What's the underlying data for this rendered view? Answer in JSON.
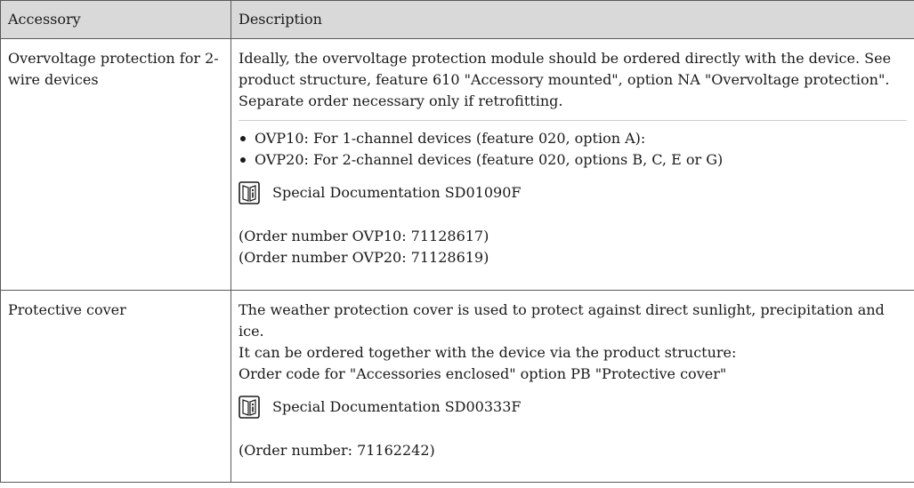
{
  "table": {
    "headers": [
      "Accessory",
      "Description"
    ],
    "rows": [
      {
        "accessory": "Overvoltage protection for 2-wire devices",
        "intro": "Ideally, the overvoltage protection module should be ordered directly with the device. See product structure, feature 610 \"Accessory mounted\", option NA \"Overvoltage protection\". Separate order necessary only if retrofitting.",
        "options": [
          "OVP10: For 1-channel devices (feature 020, option A):",
          "OVP20: For 2-channel devices (feature 020, options B, C, E or G)"
        ],
        "doc_icon": "document-info-icon",
        "doc_ref": "Special Documentation SD01090F",
        "orders": [
          "(Order number OVP10: 71128617)",
          "(Order number OVP20: 71128619)"
        ]
      },
      {
        "accessory": "Protective cover",
        "lines": [
          "The weather protection cover is used to protect against direct sunlight, precipitation and ice.",
          "It can be ordered together with the device via the product structure:",
          "Order code for \"Accessories enclosed\" option PB \"Protective cover\""
        ],
        "doc_icon": "document-info-icon",
        "doc_ref": "Special Documentation SD00333F",
        "orders": [
          "(Order number: 71162242)"
        ]
      }
    ]
  }
}
